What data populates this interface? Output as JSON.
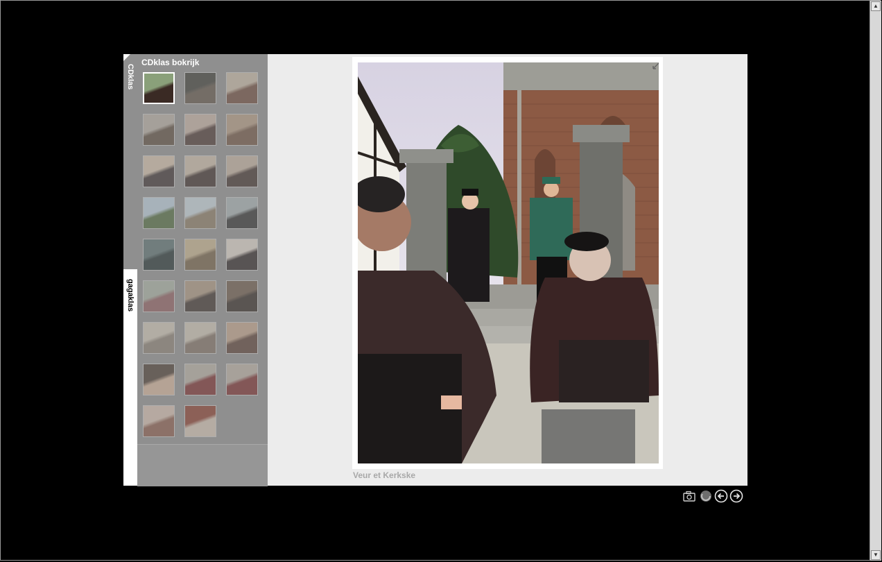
{
  "sidebar": {
    "tabs": [
      {
        "label": "CDklas"
      },
      {
        "label": "gagaklas"
      }
    ]
  },
  "album": {
    "title": "CDklas bokrijk",
    "thumbnails": [
      {
        "tones": [
          "#8aa07a",
          "#3a2a24"
        ]
      },
      {
        "tones": [
          "#3a3a34",
          "#5e5346"
        ]
      },
      {
        "tones": [
          "#c9b9a6",
          "#6e4a3a"
        ]
      },
      {
        "tones": [
          "#b7aea3",
          "#5b4b3d"
        ]
      },
      {
        "tones": [
          "#c6b2a4",
          "#4a3530"
        ]
      },
      {
        "tones": [
          "#b49a82",
          "#6f5340"
        ]
      },
      {
        "tones": [
          "#d4c1ab",
          "#3a3030"
        ]
      },
      {
        "tones": [
          "#cdbda9",
          "#3b2c28"
        ]
      },
      {
        "tones": [
          "#c5b3a0",
          "#3f2f2b"
        ]
      },
      {
        "tones": [
          "#bcd0de",
          "#4e6a3c"
        ]
      },
      {
        "tones": [
          "#c8d6de",
          "#8b7a62"
        ]
      },
      {
        "tones": [
          "#a7b2b4",
          "#2d2d2d"
        ]
      },
      {
        "tones": [
          "#5a7070",
          "#213030"
        ]
      },
      {
        "tones": [
          "#c9b48e",
          "#735f44"
        ]
      },
      {
        "tones": [
          "#e0d6cc",
          "#2c2424"
        ]
      },
      {
        "tones": [
          "#a9b3a3",
          "#8f5d5f"
        ]
      },
      {
        "tones": [
          "#ad9880",
          "#3b302b"
        ]
      },
      {
        "tones": [
          "#6c5848",
          "#2f2621"
        ]
      },
      {
        "tones": [
          "#cfc6b6",
          "#8a7f72"
        ]
      },
      {
        "tones": [
          "#cfc6b6",
          "#7f6f62"
        ]
      },
      {
        "tones": [
          "#c2a48a",
          "#5a3f33"
        ]
      },
      {
        "tones": [
          "#4a3a30",
          "#d4b59a"
        ]
      },
      {
        "tones": [
          "#b8b0a4",
          "#7a2a2a"
        ]
      },
      {
        "tones": [
          "#bbb0a4",
          "#7a2a2a"
        ]
      },
      {
        "tones": [
          "#d6c0b0",
          "#8a5a4a"
        ]
      },
      {
        "tones": [
          "#8a3a2a",
          "#d4c4b4"
        ]
      }
    ]
  },
  "viewer": {
    "caption": "Veur et Kerkske",
    "controls": [
      {
        "icon": "camera-icon"
      },
      {
        "icon": "slideshow-icon"
      },
      {
        "icon": "previous-icon"
      },
      {
        "icon": "next-icon"
      }
    ]
  }
}
